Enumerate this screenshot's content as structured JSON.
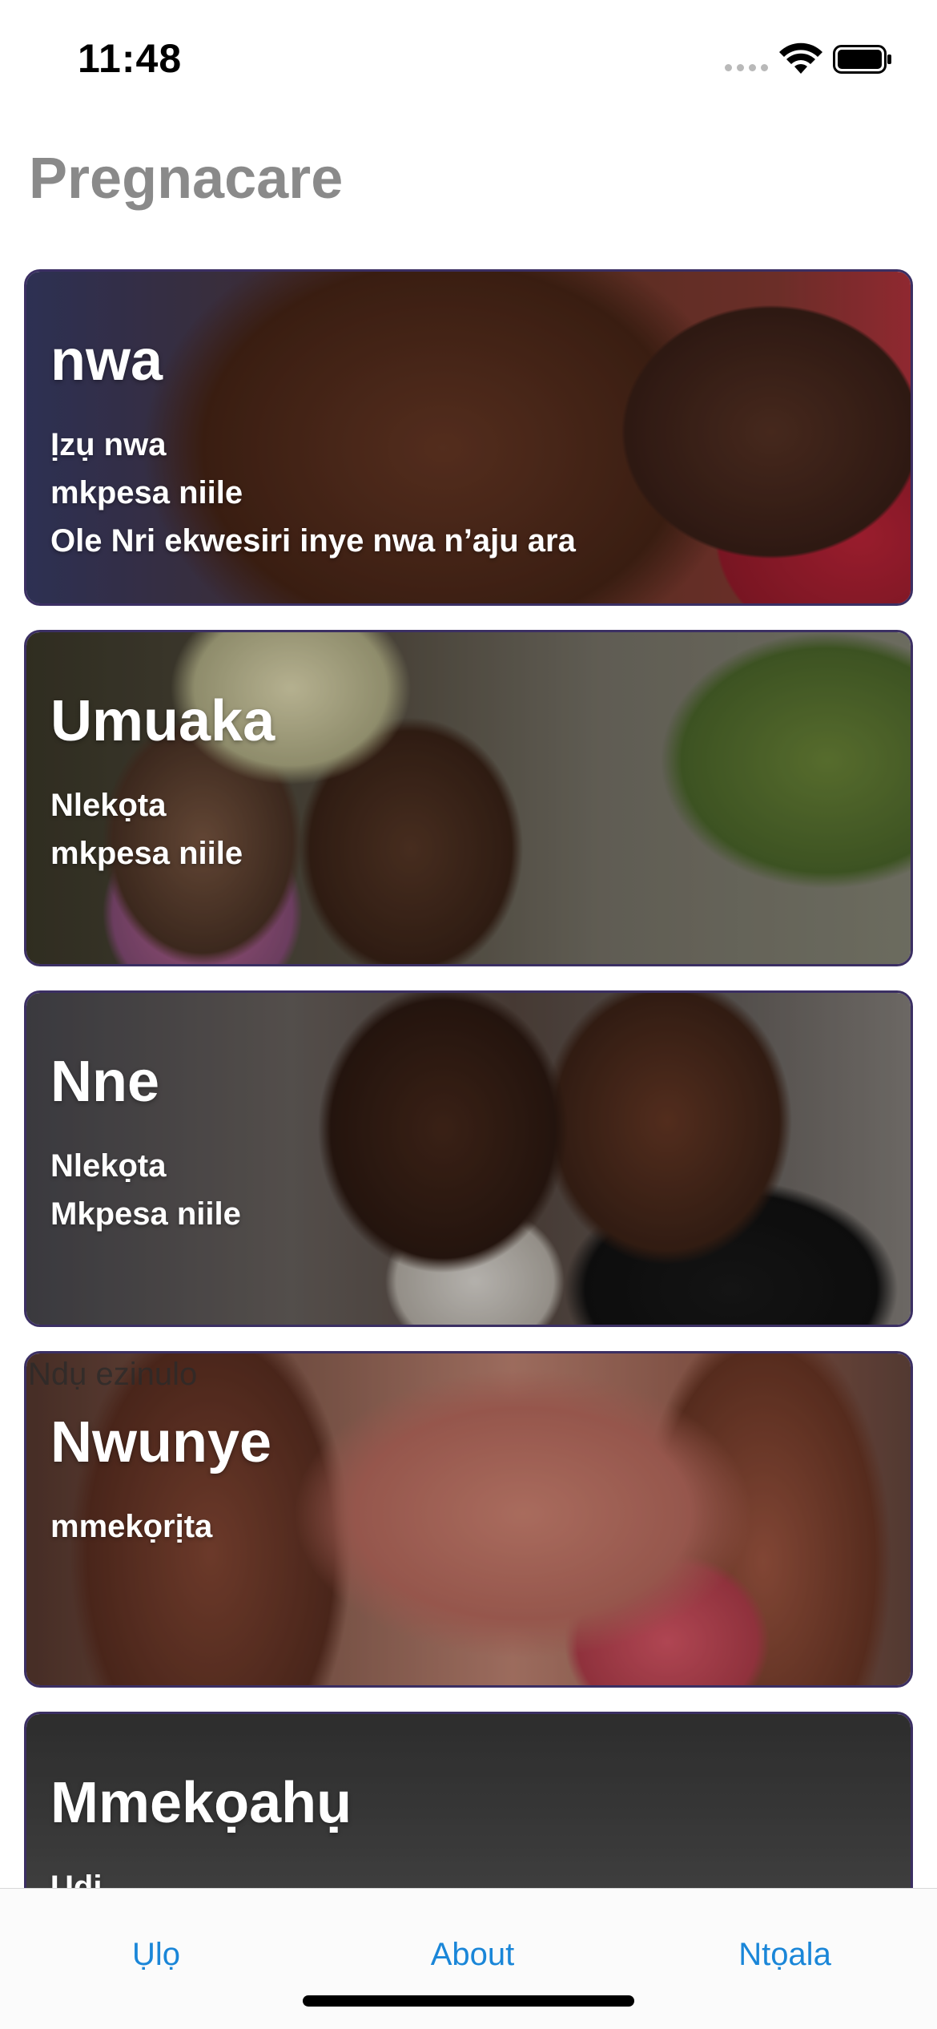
{
  "status_bar": {
    "time": "11:48",
    "icons": [
      "signal-icon",
      "wifi-icon",
      "battery-icon"
    ]
  },
  "app": {
    "title": "Pregnacare"
  },
  "cards": [
    {
      "title": "nwa",
      "lines": [
        "Ịzụ nwa",
        "mkpesa niile",
        "Ole Nri ekwesiri inye nwa n’aju ara"
      ]
    },
    {
      "title": "Umuaka",
      "lines": [
        "Nlekọta",
        "mkpesa niile"
      ]
    },
    {
      "title": "Nne",
      "lines": [
        "Nlekọta",
        "Mkpesa niile"
      ]
    },
    {
      "title": "Nwunye",
      "lines": [
        "mmekọrịta"
      ],
      "overlay_text": "Ndụ ezinulo"
    },
    {
      "title": "Mmekọahụ",
      "lines": [
        "Udi"
      ]
    }
  ],
  "tab_bar": {
    "home_label": "Ụlọ",
    "about_label": "About",
    "settings_label": "Ntọala",
    "accent_color": "#1a86d8"
  }
}
